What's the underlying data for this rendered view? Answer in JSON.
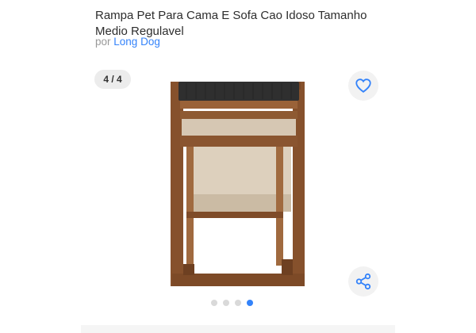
{
  "product": {
    "title": "Rampa Pet Para Cama E Sofa Cao Idoso Tamanho Medio Regulavel",
    "seller_prefix": "por",
    "seller_name": "Long Dog"
  },
  "gallery": {
    "counter": "4 / 4",
    "current_index": 4,
    "total_images": 4,
    "image_subject": "wooden folding pet ramp with dark padded top"
  },
  "icons": {
    "favorite": "heart-outline-icon",
    "share": "share-icon"
  },
  "colors": {
    "accent": "#3483fa",
    "title_text": "#2d2d2d",
    "muted_text": "#999999",
    "wood": "#8a5530",
    "button_bg": "#f2f2f2"
  }
}
